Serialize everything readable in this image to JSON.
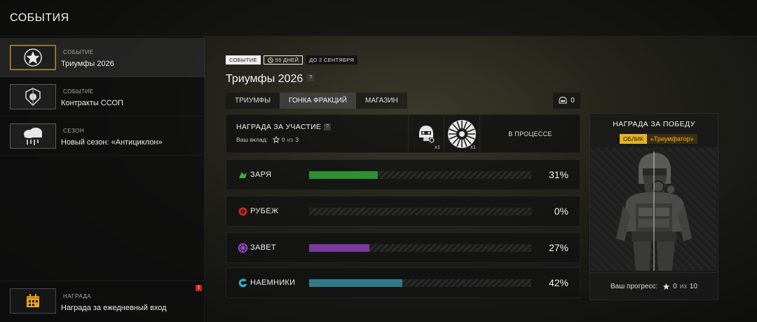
{
  "header": {
    "title": "СОБЫТИЯ"
  },
  "sidebar": {
    "items": [
      {
        "kind": "СОБЫТИЕ",
        "name": "Триумфы 2026",
        "icon": "star-emblem-icon",
        "active": true
      },
      {
        "kind": "СОБЫТИЕ",
        "name": "Контракты ССОП",
        "icon": "shield-emblem-icon",
        "active": false
      },
      {
        "kind": "СЕЗОН",
        "name": "Новый сезон: «Антициклон»",
        "icon": "storm-cloud-icon",
        "active": false
      }
    ],
    "daily": {
      "kind": "НАГРАДА",
      "name": "Награда за ежедневный вход",
      "alert": "!",
      "icon": "calendar-icon"
    }
  },
  "event": {
    "badges": {
      "type": "СОБЫТИЕ",
      "duration": "55 ДНЕЙ",
      "until": "ДО 2 СЕНТЯБРЯ"
    },
    "title": "Триумфы 2026",
    "help": "?",
    "tabs": [
      {
        "label": "ТРИУМФЫ",
        "active": false
      },
      {
        "label": "ГОНКА ФРАКЦИЙ",
        "active": true
      },
      {
        "label": "МАГАЗИН",
        "active": false
      }
    ],
    "tokens": "0"
  },
  "participation": {
    "title": "НАГРАДА ЗА УЧАСТИЕ",
    "help": "?",
    "contribution_label": "Ваш вклад:",
    "contribution_value": "0",
    "contribution_of": "из",
    "contribution_total": "3",
    "rewards": [
      {
        "icon": "helmet-icon",
        "qty": "x1"
      },
      {
        "icon": "spiral-badge-icon",
        "qty": "x1"
      }
    ],
    "status": "В ПРОЦЕССЕ"
  },
  "factions": [
    {
      "name": "ЗАРЯ",
      "percent": "31%",
      "progress": 0.31,
      "color": "#2e8f33",
      "icon": "zarya-faction-icon"
    },
    {
      "name": "РУБЕЖ",
      "percent": "0%",
      "progress": 0.0,
      "color": "#c8271f",
      "icon": "rubezh-faction-icon"
    },
    {
      "name": "ЗАВЕТ",
      "percent": "27%",
      "progress": 0.27,
      "color": "#7b3a9e",
      "icon": "zavet-faction-icon"
    },
    {
      "name": "НАЕМНИКИ",
      "percent": "42%",
      "progress": 0.42,
      "color": "#2f7a8a",
      "icon": "mercenaries-faction-icon"
    }
  ],
  "win_reward": {
    "title": "НАГРАДА ЗА ПОБЕДУ",
    "tag": "ОБЛИК",
    "name": "«Триумфатор»",
    "progress_label": "Ваш прогресс:",
    "progress_value": "0",
    "progress_of": "из",
    "progress_total": "10"
  },
  "colors": {
    "accent": "#e7b322",
    "active_border": "#b58a3a"
  }
}
